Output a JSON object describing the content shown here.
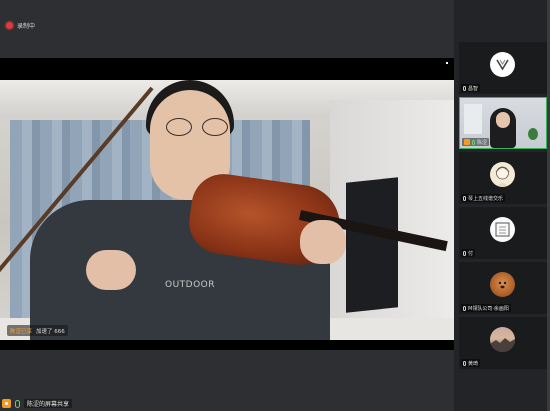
{
  "recording": {
    "label": "录制中"
  },
  "shared_video": {
    "caption_name": "陈涩已享",
    "caption_text": "加速了 666",
    "shirt_text": "OUTDOOR"
  },
  "bottom_bar": {
    "share_label": "陈涩的屏幕共享"
  },
  "participants": [
    {
      "name": "昌智",
      "avatar": "shield-avatar-icon",
      "has_video": false,
      "speaking": false
    },
    {
      "name": "陈涩",
      "avatar": "camera-feed",
      "has_video": true,
      "speaking": true,
      "sharing": true
    },
    {
      "name": "琴上五线谱交乐",
      "avatar": "sketch-girl-avatar",
      "has_video": false,
      "speaking": false
    },
    {
      "name": "付",
      "avatar": "seal-avatar",
      "has_video": false,
      "speaking": false
    },
    {
      "name": "M领队公司·余画阳",
      "avatar": "dog-avatar",
      "has_video": false,
      "speaking": false
    },
    {
      "name": "黄琦",
      "avatar": "sunset-avatar",
      "has_video": false,
      "speaking": false
    }
  ],
  "colors": {
    "background": "#2b2d30",
    "sidebar": "#232427",
    "active_border": "#3bb25c",
    "recording": "#e03b3b",
    "share_accent": "#f39c25"
  }
}
